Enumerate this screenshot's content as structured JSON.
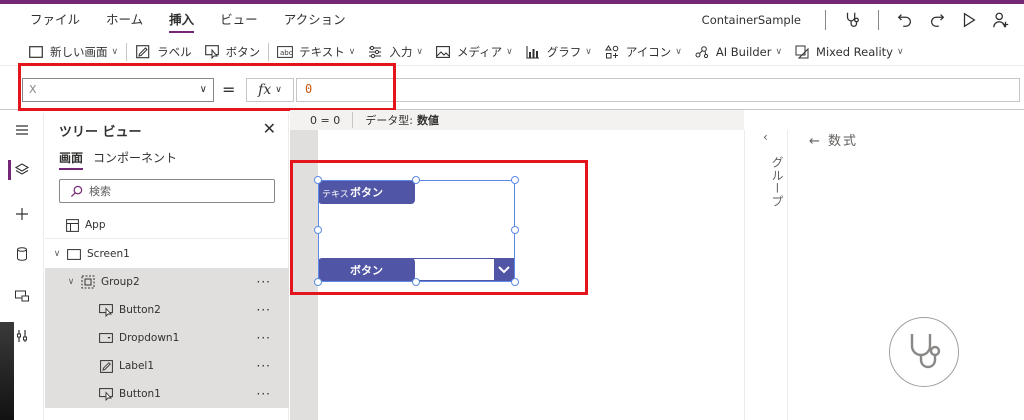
{
  "menu": {
    "items": [
      "ファイル",
      "ホーム",
      "挿入",
      "ビュー",
      "アクション"
    ],
    "active_index": 2,
    "app_name": "ContainerSample"
  },
  "toolbar": {
    "new_screen": "新しい画面",
    "label": "ラベル",
    "button": "ボタン",
    "text": "テキスト",
    "input": "入力",
    "media": "メディア",
    "chart": "グラフ",
    "icons": "アイコン",
    "ai_builder": "AI Builder",
    "mixed_reality": "Mixed Reality"
  },
  "formula": {
    "property": "X",
    "equals": "=",
    "fx": "fx",
    "value": "0"
  },
  "status": {
    "coord": "0 = 0",
    "datatype_key": "データ型:",
    "datatype_value": "数値"
  },
  "tree": {
    "title": "ツリー ビュー",
    "tabs": [
      "画面",
      "コンポーネント"
    ],
    "search_placeholder": "検索",
    "app": "App",
    "screen": "Screen1",
    "group": "Group2",
    "children": [
      "Button2",
      "Dropdown1",
      "Label1",
      "Button1"
    ],
    "more": "···"
  },
  "canvas": {
    "label_text": "テキス",
    "button_top": "ボタン",
    "button_bottom": "ボタン"
  },
  "side": {
    "group_label": "グループ",
    "back_formula": "← 数式"
  },
  "colors": {
    "accent": "#742774",
    "control": "#5155a6",
    "highlight": "#e3141c"
  }
}
